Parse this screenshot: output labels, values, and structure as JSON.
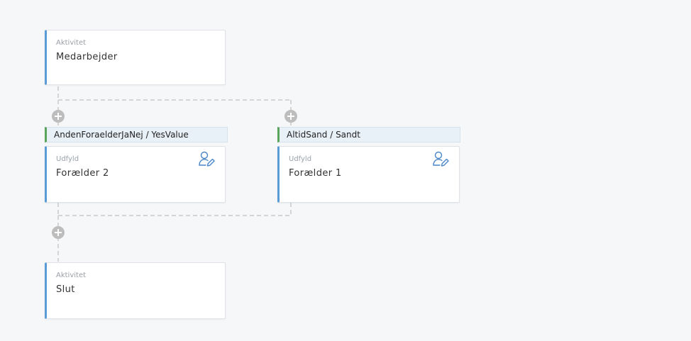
{
  "flow": {
    "start": {
      "type": "Aktivitet",
      "title": "Medarbejder"
    },
    "branches": [
      {
        "condition": "AndenForaelderJaNej / YesValue",
        "card": {
          "type": "Udfyld",
          "title": "Forælder 2",
          "icon": "user-edit-icon"
        }
      },
      {
        "condition": "AltidSand / Sandt",
        "card": {
          "type": "Udfyld",
          "title": "Forælder 1",
          "icon": "user-edit-icon"
        }
      }
    ],
    "end": {
      "type": "Aktivitet",
      "title": "Slut"
    }
  },
  "colors": {
    "activity_border": "#5b9bd5",
    "condition_border": "#5aa35a",
    "condition_background": "#e8f0f8",
    "connector": "#d5d5d5",
    "add_button": "#bdbdbd",
    "icon": "#4a86c8"
  }
}
